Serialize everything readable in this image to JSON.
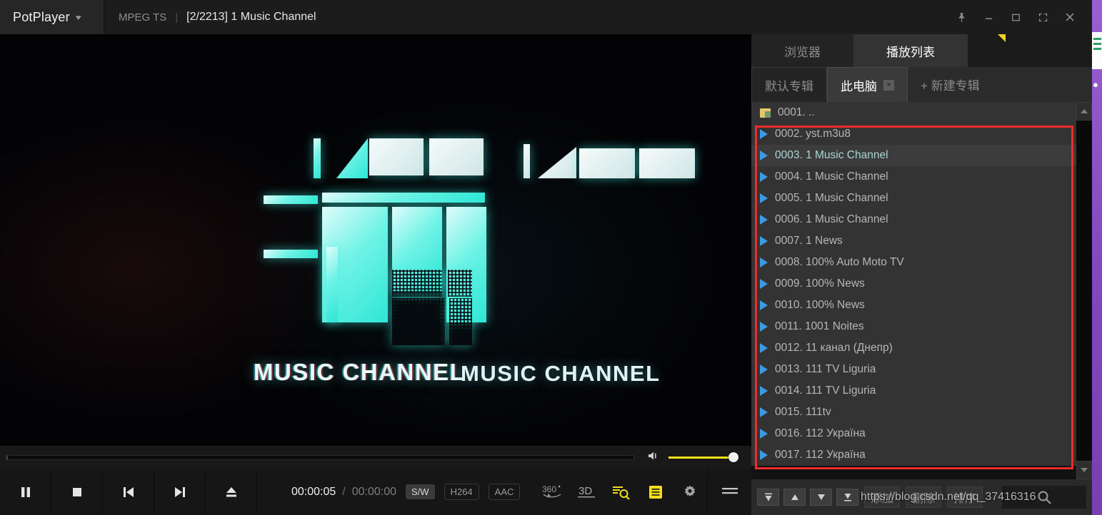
{
  "titlebar": {
    "brand": "PotPlayer",
    "brand_caret": "chevron-down",
    "format": "MPEG TS",
    "separator": "|",
    "video_title": "[2/2213] 1 Music Channel",
    "window_buttons": [
      "pin-icon",
      "minimize-icon",
      "maximize-icon",
      "fullscreen-icon",
      "close-icon"
    ]
  },
  "video": {
    "logo_text": "MUSIC CHANNEL",
    "logo_text_ghost": "MUSIC CHANNEL",
    "accent": "#2fe6d6"
  },
  "controls": {
    "pause_label": "pause",
    "stop_label": "stop",
    "prev_label": "previous",
    "next_label": "next",
    "eject_label": "eject",
    "time_current": "00:00:05",
    "time_separator": "/",
    "time_total": "00:00:00",
    "badges": [
      {
        "label": "S/W",
        "style": "fill"
      },
      {
        "label": "H264",
        "style": "out"
      },
      {
        "label": "AAC",
        "style": "out"
      }
    ],
    "tool_360": "360°",
    "tool_3d": "3D",
    "tool_subtitle": "subtitle-search-icon",
    "tool_playlist": "playlist-panel-icon",
    "tool_settings": "gear-icon",
    "menu": "hamburger-menu-icon",
    "accent_yellow": "#f2e01c"
  },
  "seek": {
    "volume_level": 100
  },
  "panel": {
    "tabs": [
      {
        "label": "浏览器",
        "active": false
      },
      {
        "label": "播放列表",
        "active": true
      }
    ],
    "albums": [
      {
        "label": "默认专辑",
        "active": false,
        "closable": false
      },
      {
        "label": "此电脑",
        "active": true,
        "closable": true,
        "close": "×"
      },
      {
        "label": "+ 新建专辑",
        "active": false,
        "closable": false
      }
    ],
    "items": [
      {
        "num": "0001.",
        "name": "..",
        "icon": "parent-folder-icon",
        "selected": false
      },
      {
        "num": "0002.",
        "name": "yst.m3u8",
        "icon": "play-icon",
        "selected": false
      },
      {
        "num": "0003.",
        "name": "1 Music Channel",
        "icon": "play-icon",
        "selected": true
      },
      {
        "num": "0004.",
        "name": "1 Music Channel",
        "icon": "play-icon",
        "selected": false
      },
      {
        "num": "0005.",
        "name": "1 Music Channel",
        "icon": "play-icon",
        "selected": false
      },
      {
        "num": "0006.",
        "name": "1 Music Channel",
        "icon": "play-icon",
        "selected": false
      },
      {
        "num": "0007.",
        "name": "1 News",
        "icon": "play-icon",
        "selected": false
      },
      {
        "num": "0008.",
        "name": "100% Auto Moto TV",
        "icon": "play-icon",
        "selected": false
      },
      {
        "num": "0009.",
        "name": "100% News",
        "icon": "play-icon",
        "selected": false
      },
      {
        "num": "0010.",
        "name": "100% News",
        "icon": "play-icon",
        "selected": false
      },
      {
        "num": "0011.",
        "name": "1001 Noites",
        "icon": "play-icon",
        "selected": false
      },
      {
        "num": "0012.",
        "name": "11 канал (Днепр)",
        "icon": "play-icon",
        "selected": false
      },
      {
        "num": "0013.",
        "name": "111 TV Liguria",
        "icon": "play-icon",
        "selected": false
      },
      {
        "num": "0014.",
        "name": "111 TV Liguria",
        "icon": "play-icon",
        "selected": false
      },
      {
        "num": "0015.",
        "name": "111tv",
        "icon": "play-icon",
        "selected": false
      },
      {
        "num": "0016.",
        "name": "112 Україна",
        "icon": "play-icon",
        "selected": false
      },
      {
        "num": "0017.",
        "name": "112 Україна",
        "icon": "play-icon",
        "selected": false
      }
    ],
    "bottom": {
      "move_top": "move-to-top",
      "move_up": "move-up",
      "move_down": "move-down",
      "move_bottom": "move-to-bottom",
      "add": "添加",
      "delete": "删除",
      "sort": "排序",
      "search": "search-icon"
    }
  },
  "annotation": {
    "color": "#ef2b2b"
  },
  "watermark": "https://blog.csdn.net/qq_37416316"
}
